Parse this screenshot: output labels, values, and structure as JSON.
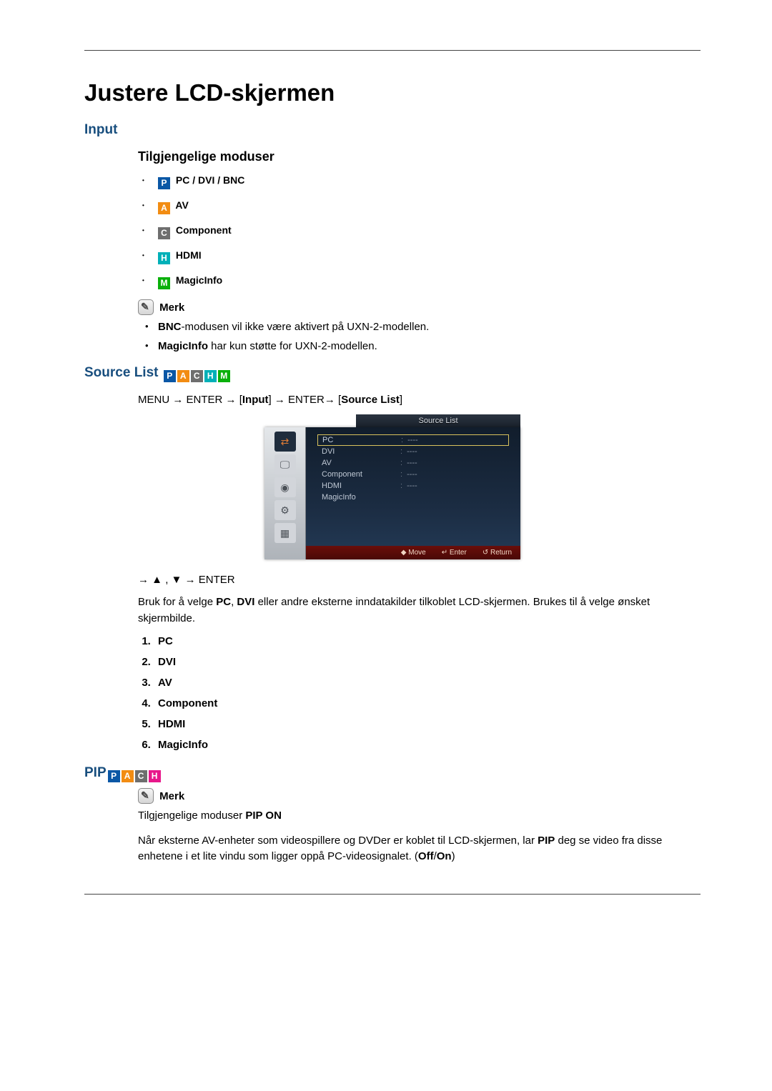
{
  "title": "Justere LCD-skjermen",
  "sections": {
    "input": {
      "heading": "Input",
      "subheading": "Tilgjengelige moduser",
      "modes": [
        {
          "letter": "P",
          "color": "blue",
          "label": "PC / DVI / BNC"
        },
        {
          "letter": "A",
          "color": "orange",
          "label": "AV"
        },
        {
          "letter": "C",
          "color": "gray",
          "label": "Component"
        },
        {
          "letter": "H",
          "color": "teal",
          "label": "HDMI"
        },
        {
          "letter": "M",
          "color": "green",
          "label": "MagicInfo"
        }
      ],
      "note_label": "Merk",
      "notes": [
        {
          "prefix": "BNC",
          "text": "-modusen vil ikke være aktivert på UXN-2-modellen."
        },
        {
          "prefix": "MagicInfo",
          "text": " har kun støtte for UXN-2-modellen."
        }
      ]
    },
    "sourcelist": {
      "heading": "Source List",
      "badge_letters": [
        "P",
        "A",
        "C",
        "H",
        "M"
      ],
      "badge_colors": [
        "blue",
        "orange",
        "gray",
        "teal",
        "green"
      ],
      "nav_parts": {
        "menu": "MENU",
        "enter": "ENTER",
        "input": "Input",
        "sourcelist": "Source List",
        "arrow": "→"
      },
      "osd": {
        "title": "Source List",
        "rows": [
          {
            "label": "PC",
            "value": "----",
            "selected": true
          },
          {
            "label": "DVI",
            "value": "----",
            "selected": false
          },
          {
            "label": "AV",
            "value": "----",
            "selected": false
          },
          {
            "label": "Component",
            "value": "----",
            "selected": false
          },
          {
            "label": "HDMI",
            "value": "----",
            "selected": false
          },
          {
            "label": "MagicInfo",
            "value": "",
            "selected": false
          }
        ],
        "footer": [
          {
            "icon": "◆",
            "label": "Move"
          },
          {
            "icon": "↵",
            "label": "Enter"
          },
          {
            "icon": "↺",
            "label": "Return"
          }
        ]
      },
      "nav2_prefix": "→",
      "nav2_up": "▲",
      "nav2_comma": ",",
      "nav2_down": "▼",
      "nav2_enter": "ENTER",
      "desc_full": "Bruk for å velge PC, DVI eller andre eksterne inndatakilder tilkoblet LCD-skjermen. Brukes til å velge ønsket skjermbilde.",
      "desc_pre": "Bruk for å velge ",
      "desc_pc": "PC",
      "desc_mid1": ", ",
      "desc_dvi": "DVI",
      "desc_post": " eller andre eksterne inndatakilder tilkoblet LCD-skjermen. Brukes til å velge ønsket skjermbilde.",
      "items": [
        "PC",
        "DVI",
        "AV",
        "Component",
        "HDMI",
        "MagicInfo"
      ]
    },
    "pip": {
      "heading": "PIP",
      "badge_letters": [
        "P",
        "A",
        "C",
        "H"
      ],
      "badge_colors": [
        "blue",
        "orange",
        "gray",
        "magenta"
      ],
      "note_label": "Merk",
      "para1_pre": "Tilgjengelige moduser ",
      "para1_bold": "PIP ON",
      "para2_pre": "Når eksterne AV-enheter som videospillere og DVDer er koblet til LCD-skjermen, lar ",
      "para2_bold1": "PIP",
      "para2_mid": " deg se video fra disse enhetene i et lite vindu som ligger oppå PC-videosignalet. (",
      "para2_bold2": "Off",
      "para2_slash": "/",
      "para2_bold3": "On",
      "para2_end": ")"
    }
  }
}
